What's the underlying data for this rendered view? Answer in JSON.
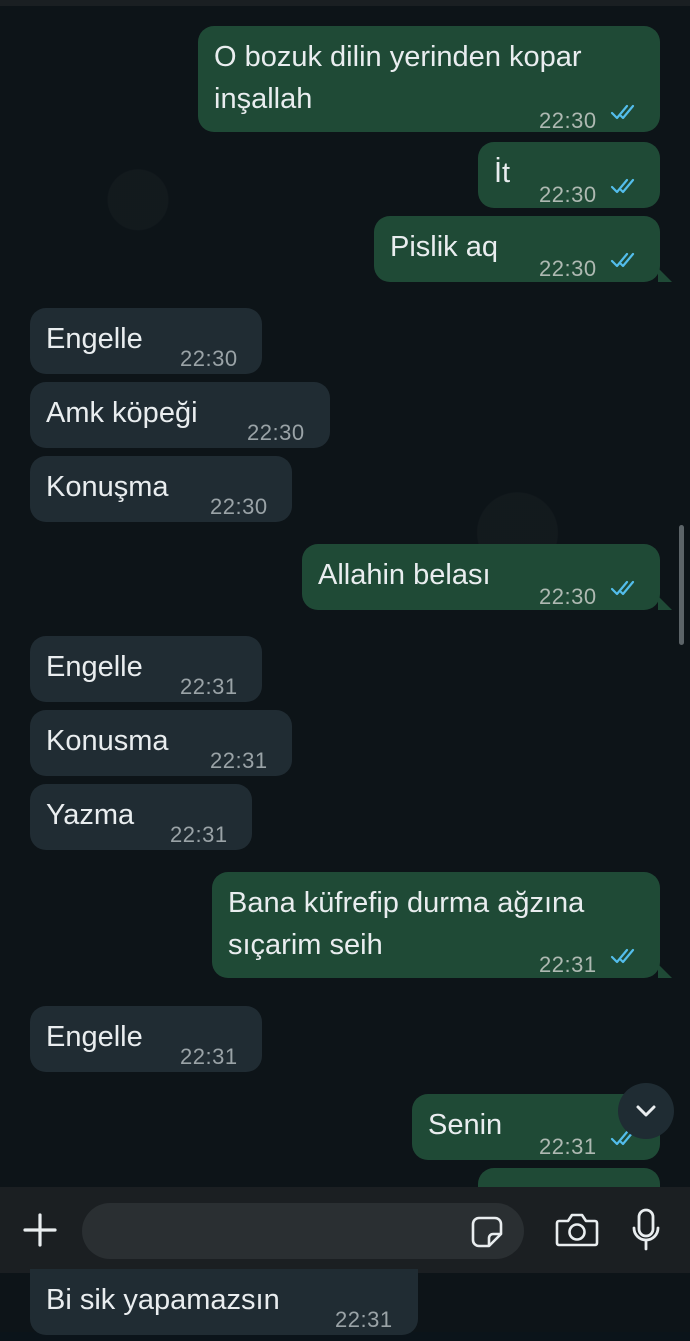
{
  "messages": [
    {
      "dir": "out",
      "lines": [
        "O bozuk dilin yerinden kopar",
        "inşallah"
      ],
      "time": "22:30",
      "ticks": true
    },
    {
      "dir": "out",
      "lines": [
        "İt"
      ],
      "time": "22:30",
      "ticks": true
    },
    {
      "dir": "out",
      "lines": [
        "Pislik aq"
      ],
      "time": "22:30",
      "ticks": true
    },
    {
      "dir": "in",
      "lines": [
        "Engelle"
      ],
      "time": "22:30"
    },
    {
      "dir": "in",
      "lines": [
        "Amk köpeği"
      ],
      "time": "22:30"
    },
    {
      "dir": "in",
      "lines": [
        "Konuşma"
      ],
      "time": "22:30"
    },
    {
      "dir": "out",
      "lines": [
        "Allahin belası"
      ],
      "time": "22:30",
      "ticks": true
    },
    {
      "dir": "in",
      "lines": [
        "Engelle"
      ],
      "time": "22:31"
    },
    {
      "dir": "in",
      "lines": [
        "Konusma"
      ],
      "time": "22:31"
    },
    {
      "dir": "in",
      "lines": [
        "Yazma"
      ],
      "time": "22:31"
    },
    {
      "dir": "out",
      "lines": [
        "Bana küfrefip durma ağzına",
        "sıçarim seih"
      ],
      "time": "22:31",
      "ticks": true
    },
    {
      "dir": "in",
      "lines": [
        "Engelle"
      ],
      "time": "22:31"
    },
    {
      "dir": "out",
      "lines": [
        "Senin"
      ],
      "time": "22:31",
      "ticks": true
    }
  ],
  "composer": {
    "value": ""
  },
  "bottom_message": {
    "text": "Bi sik yapamazsın",
    "time": "22:31"
  },
  "colors": {
    "outgoing": "#1f4a36",
    "incoming": "#202c33",
    "ticks": "#53bdeb"
  },
  "icons": [
    "plus-icon",
    "sticker-icon",
    "camera-icon",
    "microphone-icon",
    "chevron-down-icon",
    "double-check-icon"
  ]
}
